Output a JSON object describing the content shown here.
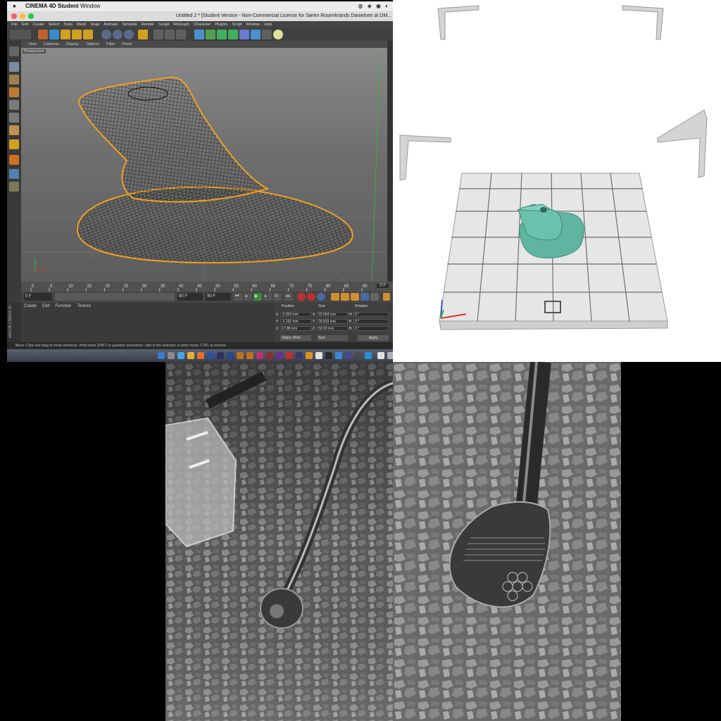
{
  "mac_menubar": {
    "apple": "",
    "app_name": "CINEMA 4D Student",
    "window_menu": "Window"
  },
  "window": {
    "title": "Untitled 2 * [Student Version - Non-Commercial License for Søren Rosenkrands Danielsen at DM..."
  },
  "menu": {
    "items": [
      "File",
      "Edit",
      "Create",
      "Select",
      "Tools",
      "Mesh",
      "Snap",
      "Animate",
      "Simulate",
      "Render",
      "Sculpt",
      "MoGraph",
      "Character",
      "Plugins",
      "Script",
      "Window",
      "Help"
    ]
  },
  "viewport": {
    "menu": [
      "View",
      "Cameras",
      "Display",
      "Options",
      "Filter",
      "Panel"
    ],
    "label": "Perspective"
  },
  "timeline": {
    "ticks": [
      "0",
      "5",
      "10",
      "15",
      "20",
      "25",
      "30",
      "35",
      "40",
      "45",
      "50",
      "55",
      "60",
      "65",
      "70",
      "75",
      "80",
      "85",
      "90"
    ],
    "end_field": "0 F"
  },
  "transport": {
    "start": "0 F",
    "min_field": "0 F",
    "max_field": "90 F",
    "end": "90 F"
  },
  "material_manager": {
    "menu": [
      "Create",
      "Edit",
      "Function",
      "Texture"
    ]
  },
  "coordinates": {
    "headers": [
      "Position",
      "Size",
      "Rotation"
    ],
    "rows": [
      {
        "axis": "X",
        "position": "-0.003 mm",
        "size_axis": "X",
        "size": "32.054 mm",
        "rot_axis": "H",
        "rotation": "0 °"
      },
      {
        "axis": "Y",
        "position": "-1.232 mm",
        "size_axis": "Y",
        "size": "29.819 mm",
        "rot_axis": "P",
        "rotation": "0 °"
      },
      {
        "axis": "Z",
        "position": "17.88 mm",
        "size_axis": "Z",
        "size": "50.59 mm",
        "rot_axis": "B",
        "rotation": "0 °"
      }
    ],
    "mode_select": "Object (Rel)",
    "size_select": "Size",
    "apply_label": "Apply"
  },
  "brand": "MAXON CINEMA 4D",
  "status": {
    "text": "Move: Click and drag to move elements. Hold down SHIFT to quantize movement / add to the selection in point mode, CTRL to remove."
  },
  "colors": {
    "selection_outline": "#f0a020",
    "slicer_model": "#5fb5a0",
    "slicer_plate": "#e6e6e6",
    "axis_x": "#e03030",
    "axis_y": "#30c030",
    "axis_z": "#3050e0"
  },
  "icons": [
    "apple-icon",
    "undo-icon",
    "move-icon",
    "scale-icon",
    "rotate-icon",
    "x-axis-icon",
    "y-axis-icon",
    "z-axis-icon",
    "render-icon",
    "cube-icon",
    "play-icon",
    "record-icon"
  ]
}
